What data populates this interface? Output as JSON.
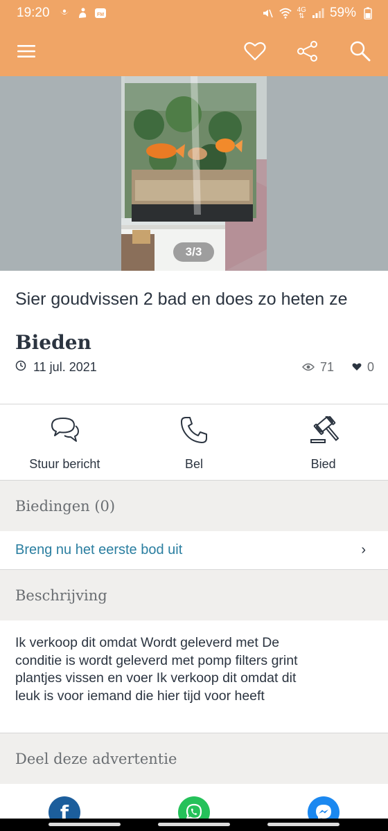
{
  "status_bar": {
    "time": "19:20",
    "battery": "59%",
    "network": "4G"
  },
  "toolbar": {
    "menu_icon": "hamburger-menu-icon",
    "favorite_icon": "heart-outline-icon",
    "share_icon": "share-icon",
    "search_icon": "search-icon"
  },
  "gallery": {
    "counter": "3/3"
  },
  "listing": {
    "title": "Sier goudvissen 2 bad en does zo heten ze",
    "price": "Bieden",
    "date": "11 jul. 2021",
    "views": "71",
    "favorites": "0"
  },
  "actions": [
    {
      "label": "Stuur bericht",
      "icon": "chat-bubbles-icon"
    },
    {
      "label": "Bel",
      "icon": "phone-icon"
    },
    {
      "label": "Bied",
      "icon": "gavel-icon"
    }
  ],
  "bids": {
    "header": "Biedingen (0)",
    "cta": "Breng nu het eerste bod uit",
    "chevron": "›"
  },
  "description": {
    "header": "Beschrijving",
    "lines": [
      "Ik verkoop dit omdat Wordt geleverd met De",
      "conditie is wordt geleverd met pomp filters grint",
      "plantjes vissen en voer Ik verkoop dit omdat dit",
      "leuk is voor iemand die hier tijd voor heeft"
    ]
  },
  "share": {
    "header": "Deel deze advertentie",
    "buttons": [
      {
        "icon": "facebook-icon",
        "glyph": "f",
        "color": "#1c5e9c"
      },
      {
        "icon": "whatsapp-icon",
        "glyph": "",
        "color": "#25c15a"
      },
      {
        "icon": "messenger-icon",
        "glyph": "",
        "color": "#1b88f0"
      }
    ]
  },
  "colors": {
    "brand_orange": "#f0a566",
    "link_blue": "#2a7ea0",
    "text_dark": "#2b3440",
    "section_grey": "#f0efed"
  }
}
